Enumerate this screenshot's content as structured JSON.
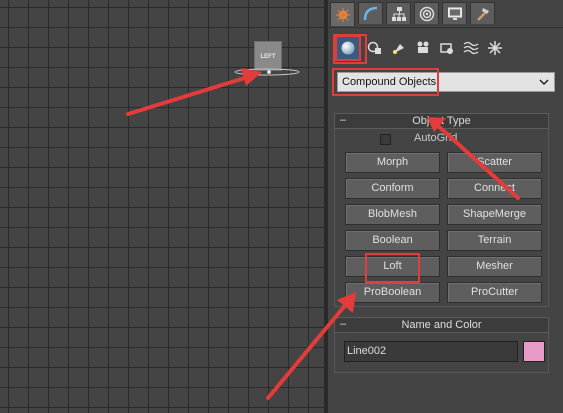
{
  "viewport": {
    "label": "LEFT"
  },
  "command_panel": {
    "tabs": [
      {
        "icon": "create-icon",
        "active": true
      },
      {
        "icon": "modify-icon"
      },
      {
        "icon": "hierarchy-icon"
      },
      {
        "icon": "motion-icon"
      },
      {
        "icon": "display-icon"
      },
      {
        "icon": "utilities-icon"
      }
    ],
    "categories": [
      {
        "icon": "geometry-icon",
        "active": true
      },
      {
        "icon": "shapes-icon"
      },
      {
        "icon": "lights-icon"
      },
      {
        "icon": "cameras-icon"
      },
      {
        "icon": "helpers-icon"
      },
      {
        "icon": "space-warps-icon"
      },
      {
        "icon": "systems-icon"
      }
    ],
    "dropdown": {
      "selected": "Compound Objects"
    }
  },
  "object_type": {
    "title": "Object Type",
    "collapse_symbol": "–",
    "autogrid_label": "AutoGrid",
    "buttons": [
      "Morph",
      "Scatter",
      "Conform",
      "Connect",
      "BlobMesh",
      "ShapeMerge",
      "Boolean",
      "Terrain",
      "Loft",
      "Mesher",
      "ProBoolean",
      "ProCutter"
    ]
  },
  "name_and_color": {
    "title": "Name and Color",
    "collapse_symbol": "–",
    "name_value": "Line002",
    "swatch_color": "#e79cc7"
  },
  "colors": {
    "annotation_red": "#e43b3b"
  }
}
